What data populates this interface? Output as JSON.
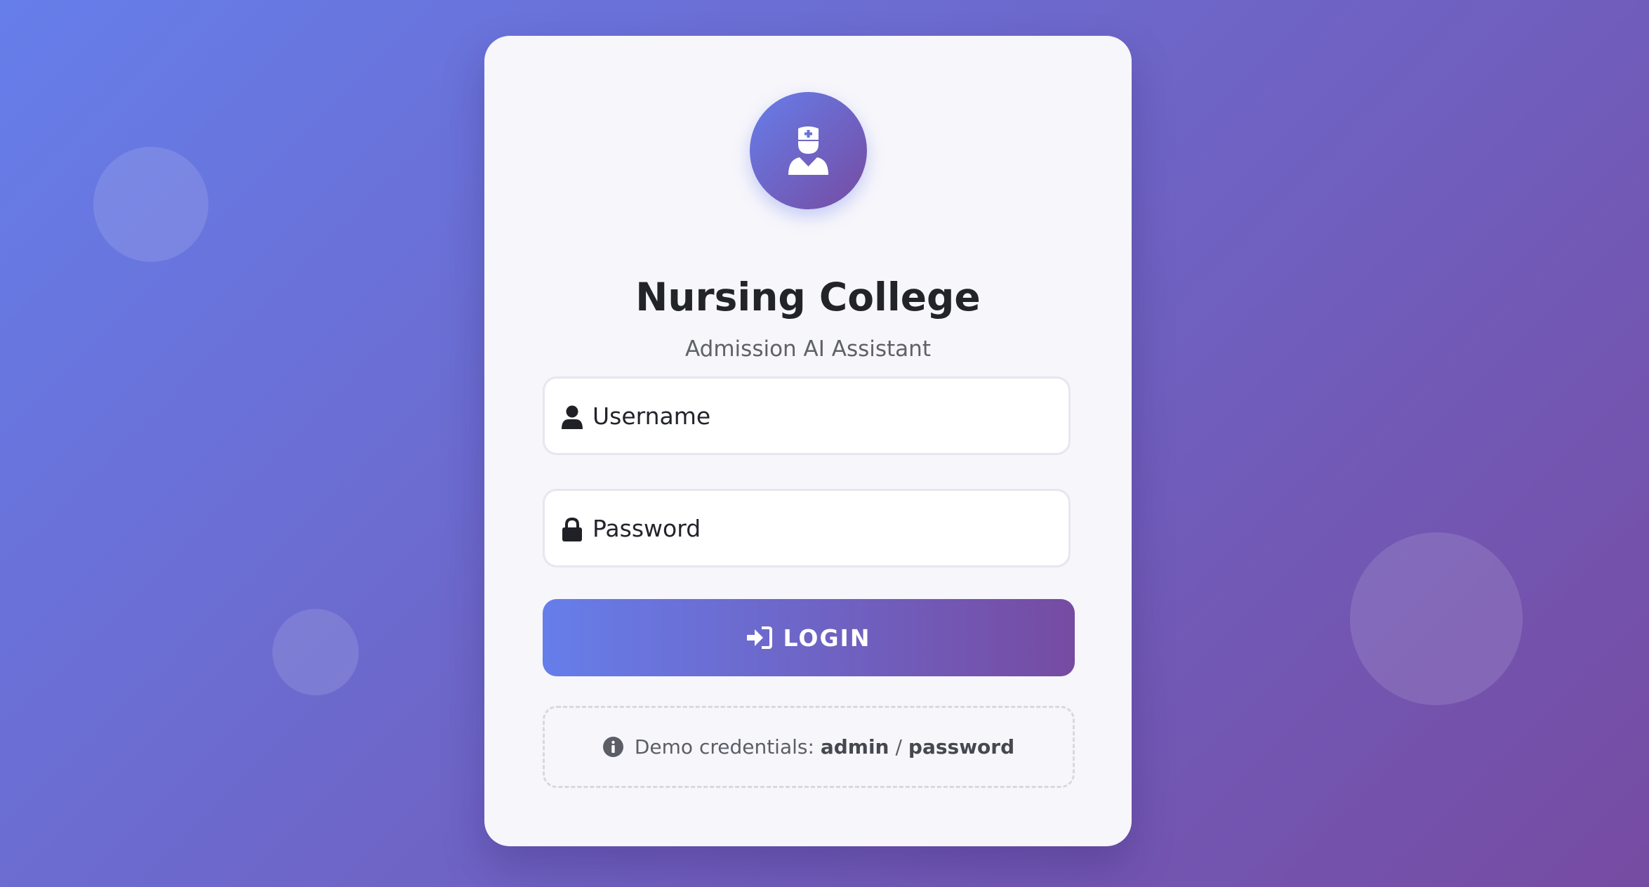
{
  "brand": {
    "title": "Nursing College",
    "subtitle": "Admission AI Assistant",
    "logo_icon": "nurse-icon"
  },
  "form": {
    "username": {
      "placeholder": "Username",
      "value": "",
      "icon": "user-icon"
    },
    "password": {
      "placeholder": "Password",
      "value": "",
      "icon": "lock-icon"
    },
    "login_label": "LOGIN",
    "login_icon": "sign-in-icon"
  },
  "demo": {
    "prefix": "Demo credentials:",
    "username": "admin",
    "separator": "/",
    "password": "password",
    "icon": "info-icon"
  },
  "colors": {
    "gradient_start": "#667eea",
    "gradient_end": "#764ba2",
    "card_background": "#f7f6fb"
  }
}
